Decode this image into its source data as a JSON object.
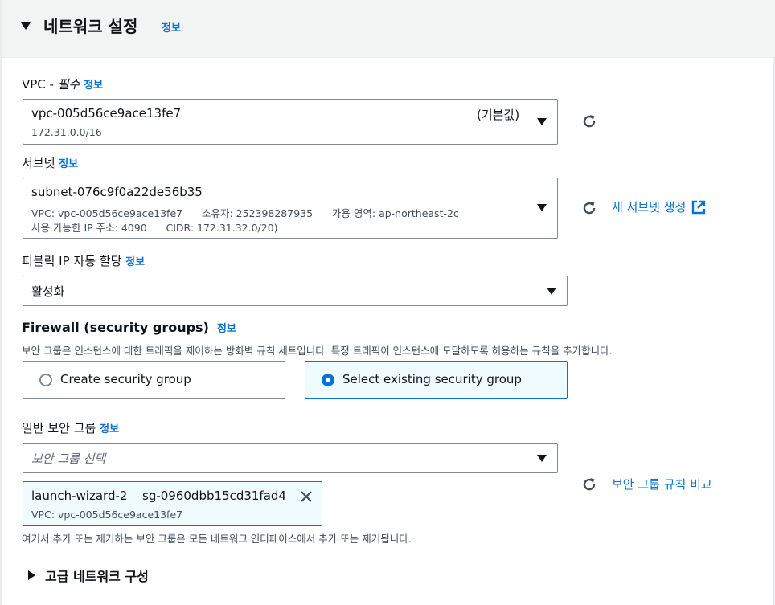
{
  "section": {
    "title": "네트워크 설정",
    "info": "정보"
  },
  "vpc": {
    "label_prefix": "VPC - ",
    "label_required": "필수",
    "info": "정보",
    "value": "vpc-005d56ce9ace13fe7",
    "cidr": "172.31.0.0/16",
    "tag": "(기본값)"
  },
  "subnet": {
    "label": "서브넷",
    "info": "정보",
    "value": "subnet-076c9f0a22de56b35",
    "line1": "VPC: vpc-005d56ce9ace13fe7      소유자: 252398287935      가용 영역: ap-northeast-2c",
    "line2": "사용 가능한 IP 주소: 4090      CIDR: 172.31.32.0/20)",
    "create_link": "새 서브넷 생성"
  },
  "public_ip": {
    "label": "퍼블릭 IP 자동 할당",
    "info": "정보",
    "value": "활성화"
  },
  "firewall": {
    "title": "Firewall (security groups)",
    "info": "정보",
    "description": "보안 그룹은 인스턴스에 대한 트래픽을 제어하는 방화벽 규칙 세트입니다. 특정 트래픽이 인스턴스에 도달하도록 허용하는 규칙을 추가합니다.",
    "options": [
      {
        "label": "Create security group",
        "selected": false
      },
      {
        "label": "Select existing security group",
        "selected": true
      }
    ]
  },
  "common_sg": {
    "label": "일반 보안 그룹",
    "info": "정보",
    "placeholder": "보안 그룹 선택",
    "compare_link": "보안 그룹 규칙 비교",
    "token": {
      "name": "launch-wizard-2",
      "id": "sg-0960dbb15cd31fad4",
      "vpc": "VPC: vpc-005d56ce9ace13fe7"
    },
    "hint": "여기서 추가 또는 제거하는 보안 그룹은 모든 네트워크 인터페이스에서 추가 또는 제거됩니다."
  },
  "advanced": {
    "label": "고급 네트워크 구성"
  },
  "colors": {
    "link": "#0972d3",
    "border": "#7d8998",
    "selected_bg": "#f0fbff",
    "header_bg": "#f2f3f3"
  }
}
